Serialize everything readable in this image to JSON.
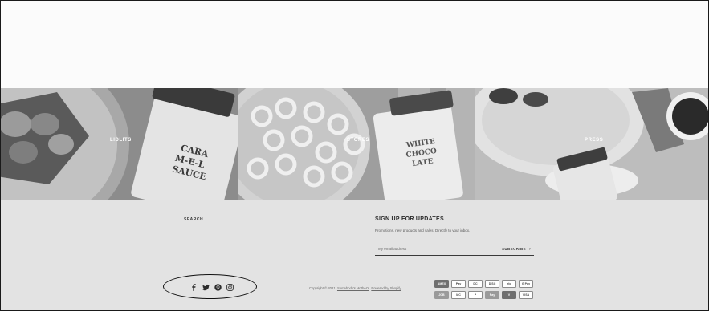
{
  "promo_tiles": [
    {
      "label": "LIDLITS",
      "jar_text": [
        "CARA",
        "M-E-L",
        "SAUCE"
      ]
    },
    {
      "label": "STORES",
      "jar_text": [
        "WHITE",
        "CHOCO",
        "LATE"
      ]
    },
    {
      "label": "PRESS"
    }
  ],
  "footer": {
    "search_link": "SEARCH",
    "signup": {
      "title": "SIGN UP FOR UPDATES",
      "description": "Promotions, new products and sales. Directly to your inbox.",
      "email_placeholder": "My email address",
      "subscribe_label": "SUBSCRIBE",
      "subscribe_arrow": "›"
    },
    "social_icons": [
      "facebook-icon",
      "twitter-icon",
      "pinterest-icon",
      "instagram-icon"
    ],
    "copyright_prefix": "Copyright © 2021, ",
    "copyright_shop": "Somebody's Mother's",
    "copyright_sep": ". ",
    "copyright_powered": "Powered by Shopify",
    "payment_methods": [
      {
        "name": "amex",
        "label": "AMEX"
      },
      {
        "name": "apple-pay",
        "label": "Pay"
      },
      {
        "name": "diners-club",
        "label": "DC"
      },
      {
        "name": "discover",
        "label": "DISC"
      },
      {
        "name": "elo",
        "label": "elo"
      },
      {
        "name": "google-pay",
        "label": "G Pay"
      },
      {
        "name": "jcb",
        "label": "JCB"
      },
      {
        "name": "mastercard",
        "label": "MC"
      },
      {
        "name": "paypal",
        "label": "P"
      },
      {
        "name": "shop-pay",
        "label": "Pay"
      },
      {
        "name": "venmo",
        "label": "V"
      },
      {
        "name": "visa",
        "label": "VISA"
      }
    ]
  }
}
